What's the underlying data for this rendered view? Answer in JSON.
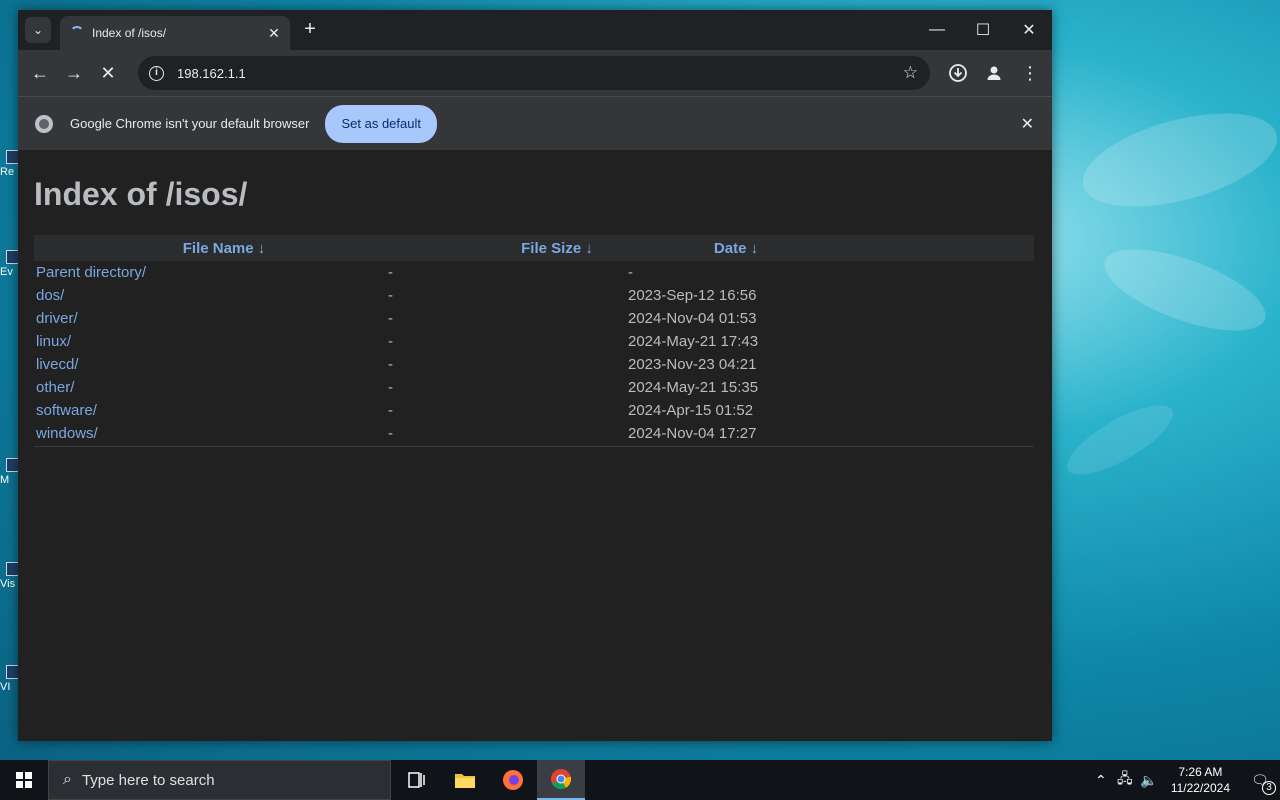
{
  "browser": {
    "tab_title": "Index of /isos/",
    "url": "198.162.1.1",
    "window_controls": {
      "minimize": "—",
      "maximize": "☐",
      "close": "✕"
    }
  },
  "infobar": {
    "message": "Google Chrome isn't your default browser",
    "button_label": "Set as default"
  },
  "page": {
    "title": "Index of /isos/",
    "columns": {
      "name": "File Name  ↓",
      "size": "File Size  ↓",
      "date": "Date  ↓"
    },
    "rows": [
      {
        "name": "Parent directory/",
        "size": "-",
        "date": "-"
      },
      {
        "name": "dos/",
        "size": "-",
        "date": "2023-Sep-12 16:56"
      },
      {
        "name": "driver/",
        "size": "-",
        "date": "2024-Nov-04 01:53"
      },
      {
        "name": "linux/",
        "size": "-",
        "date": "2024-May-21 17:43"
      },
      {
        "name": "livecd/",
        "size": "-",
        "date": "2023-Nov-23 04:21"
      },
      {
        "name": "other/",
        "size": "-",
        "date": "2024-May-21 15:35"
      },
      {
        "name": "software/",
        "size": "-",
        "date": "2024-Apr-15 01:52"
      },
      {
        "name": "windows/",
        "size": "-",
        "date": "2024-Nov-04 17:27"
      }
    ]
  },
  "taskbar": {
    "search_placeholder": "Type here to search",
    "time": "7:26 AM",
    "date": "11/22/2024",
    "notification_count": "3"
  },
  "desktop_icons": [
    "Re",
    "Ev",
    "M",
    "Vis",
    "VI"
  ]
}
